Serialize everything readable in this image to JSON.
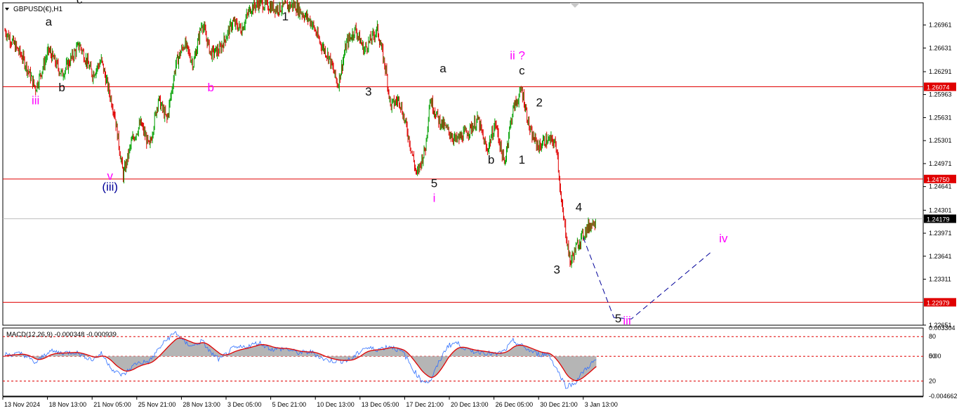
{
  "header": {
    "symbol_title": "GBPUSD(€),H1",
    "menu_icon": "triangle-down-icon"
  },
  "indicator": {
    "title": "MACD(12,26,9) -0.000348 -0.000939"
  },
  "colors": {
    "bull": "#00a000",
    "bear": "#e00000",
    "level": "#e00000",
    "wave_pink": "#ff00ff",
    "wave_navy": "#000099",
    "wave_black": "#111111",
    "projection": "#000099"
  },
  "chart_data": [
    {
      "type": "candlestick",
      "title": "GBPUSD(€),H1",
      "timeframe": "H1",
      "ylim": [
        1.2265,
        1.2728
      ],
      "price_ticks": [
        "1.26961",
        "1.26631",
        "1.26291",
        "1.25963",
        "1.25631",
        "1.25301",
        "1.24971",
        "1.24641",
        "1.24301",
        "1.23971",
        "1.23641",
        "1.23311",
        "1.22651"
      ],
      "x_labels": [
        "13 Nov 2024",
        "18 Nov 13:00",
        "21 Nov 05:00",
        "25 Nov 21:00",
        "28 Nov 13:00",
        "3 Dec 05:00",
        "5 Dec 21:00",
        "10 Dec 13:00",
        "13 Dec 05:00",
        "17 Dec 21:00",
        "20 Dec 13:00",
        "26 Dec 05:00",
        "30 Dec 21:00",
        "3 Jan 13:00"
      ],
      "price_path": [
        [
          0,
          1.2688
        ],
        [
          4,
          1.265
        ],
        [
          7,
          1.2605
        ],
        [
          10,
          1.266
        ],
        [
          13,
          1.2625
        ],
        [
          17,
          1.2668
        ],
        [
          20,
          1.2625
        ],
        [
          22,
          1.2645
        ],
        [
          25,
          1.257
        ],
        [
          27,
          1.248
        ],
        [
          29,
          1.253
        ],
        [
          31,
          1.2555
        ],
        [
          33,
          1.252
        ],
        [
          35,
          1.259
        ],
        [
          37,
          1.256
        ],
        [
          39,
          1.264
        ],
        [
          41,
          1.267
        ],
        [
          43,
          1.264
        ],
        [
          45,
          1.27
        ],
        [
          47,
          1.2655
        ],
        [
          49,
          1.266
        ],
        [
          52,
          1.27
        ],
        [
          54,
          1.269
        ],
        [
          56,
          1.272
        ],
        [
          58,
          1.2728
        ],
        [
          62,
          1.272
        ],
        [
          66,
          1.2725
        ],
        [
          70,
          1.27
        ],
        [
          72,
          1.267
        ],
        [
          74,
          1.265
        ],
        [
          76,
          1.261
        ],
        [
          78,
          1.267
        ],
        [
          80,
          1.269
        ],
        [
          82,
          1.266
        ],
        [
          85,
          1.269
        ],
        [
          87,
          1.263
        ],
        [
          88,
          1.258
        ],
        [
          90,
          1.259
        ],
        [
          92,
          1.254
        ],
        [
          94,
          1.248
        ],
        [
          96,
          1.252
        ],
        [
          97,
          1.259
        ],
        [
          99,
          1.256
        ],
        [
          101,
          1.2545
        ],
        [
          103,
          1.253
        ],
        [
          106,
          1.2545
        ],
        [
          108,
          1.256
        ],
        [
          110,
          1.2515
        ],
        [
          112,
          1.2555
        ],
        [
          114,
          1.2495
        ],
        [
          115,
          1.254
        ],
        [
          116,
          1.2575
        ],
        [
          118,
          1.2603
        ],
        [
          120,
          1.254
        ],
        [
          122,
          1.252
        ],
        [
          123,
          1.253
        ],
        [
          125,
          1.253
        ],
        [
          126,
          1.252
        ],
        [
          127,
          1.244
        ],
        [
          128,
          1.24
        ],
        [
          129,
          1.2355
        ],
        [
          131,
          1.2385
        ],
        [
          133,
          1.2405
        ],
        [
          135,
          1.2418
        ]
      ],
      "horizontal_levels": [
        {
          "price": 1.26074,
          "label": "1.26074",
          "color": "#e00000"
        },
        {
          "price": 1.2475,
          "label": "1.24750",
          "color": "#e00000"
        },
        {
          "price": 1.24179,
          "label": "1.24179",
          "color": "#bdbdbd",
          "current": true
        },
        {
          "price": 1.22979,
          "label": "1.22979",
          "color": "#e00000"
        }
      ],
      "wave_labels": [
        {
          "text": "a",
          "bar": 10,
          "price": 1.2695,
          "color": "black"
        },
        {
          "text": "c",
          "bar": 17,
          "price": 1.2727,
          "color": "black"
        },
        {
          "text": "b",
          "bar": 13,
          "price": 1.2601,
          "color": "black"
        },
        {
          "text": "iii",
          "bar": 7,
          "price": 1.2582,
          "color": "magenta"
        },
        {
          "text": "v",
          "bar": 24,
          "price": 1.2474,
          "color": "magenta"
        },
        {
          "text": "(iii)",
          "bar": 24,
          "price": 1.2458,
          "color": "navy"
        },
        {
          "text": "b",
          "bar": 47,
          "price": 1.2601,
          "color": "magenta"
        },
        {
          "text": "1",
          "bar": 64,
          "price": 1.2703,
          "color": "black"
        },
        {
          "text": "3",
          "bar": 83,
          "price": 1.2595,
          "color": "black"
        },
        {
          "text": "a",
          "bar": 100,
          "price": 1.2628,
          "color": "black"
        },
        {
          "text": "5",
          "bar": 98,
          "price": 1.2463,
          "color": "black"
        },
        {
          "text": "i",
          "bar": 98,
          "price": 1.2442,
          "color": "magenta"
        },
        {
          "text": "b",
          "bar": 111,
          "price": 1.2497,
          "color": "black"
        },
        {
          "text": "ii ?",
          "bar": 117,
          "price": 1.2647,
          "color": "magenta"
        },
        {
          "text": "c",
          "bar": 118,
          "price": 1.2625,
          "color": "black"
        },
        {
          "text": "2",
          "bar": 122,
          "price": 1.2579,
          "color": "black"
        },
        {
          "text": "1",
          "bar": 118,
          "price": 1.2497,
          "color": "black"
        },
        {
          "text": "4",
          "bar": 131,
          "price": 1.2429,
          "color": "black"
        },
        {
          "text": "3",
          "bar": 126,
          "price": 1.2339,
          "color": "black"
        },
        {
          "text": "5",
          "bar": 140,
          "price": 1.2269,
          "color": "black"
        },
        {
          "text": "iii",
          "bar": 142,
          "price": 1.2266,
          "color": "magenta"
        },
        {
          "text": "iv",
          "bar": 164,
          "price": 1.2384,
          "color": "magenta"
        }
      ],
      "projection": [
        [
          132,
          1.2391
        ],
        [
          139,
          1.2276
        ],
        [
          143,
          1.2274
        ],
        [
          161,
          1.2369
        ]
      ]
    },
    {
      "type": "line",
      "title": "MACD(12,26,9) -0.000348 -0.000939",
      "series": [
        {
          "role": "main",
          "color": "#3070ff"
        },
        {
          "role": "signal",
          "color": "#e00000"
        },
        {
          "role": "histogram",
          "color": "#b5b5b5"
        }
      ],
      "ylim": [
        -0.004662,
        0.003304
      ],
      "value_ticks": [
        "0.003304",
        "0.00",
        "-0.004662"
      ],
      "levels": [
        "80",
        "50",
        "20"
      ],
      "macd_path": [
        [
          0,
          0.0002
        ],
        [
          4,
          0.0003
        ],
        [
          7,
          -0.0008
        ],
        [
          10,
          0.0006
        ],
        [
          13,
          0.0004
        ],
        [
          16,
          0.0005
        ],
        [
          20,
          -0.0004
        ],
        [
          22,
          0.0003
        ],
        [
          25,
          -0.0018
        ],
        [
          27,
          -0.0022
        ],
        [
          30,
          -0.0008
        ],
        [
          33,
          -0.0006
        ],
        [
          35,
          0.0008
        ],
        [
          37,
          0.002
        ],
        [
          39,
          0.0028
        ],
        [
          41,
          0.0016
        ],
        [
          43,
          0.0012
        ],
        [
          45,
          0.0018
        ],
        [
          47,
          0.0004
        ],
        [
          49,
          -0.0004
        ],
        [
          52,
          0.0009
        ],
        [
          55,
          0.0011
        ],
        [
          58,
          0.0016
        ],
        [
          61,
          0.0008
        ],
        [
          64,
          0.0009
        ],
        [
          67,
          0.0004
        ],
        [
          70,
          0.0005
        ],
        [
          73,
          -0.0004
        ],
        [
          76,
          -0.0006
        ],
        [
          79,
          -0.0004
        ],
        [
          82,
          0.001
        ],
        [
          85,
          0.0008
        ],
        [
          88,
          0.0012
        ],
        [
          91,
          0.0004
        ],
        [
          93,
          -0.0014
        ],
        [
          95,
          -0.0028
        ],
        [
          97,
          -0.003
        ],
        [
          99,
          -0.0008
        ],
        [
          101,
          0.0012
        ],
        [
          103,
          0.0016
        ],
        [
          106,
          0.0006
        ],
        [
          109,
          0.0005
        ],
        [
          112,
          0.0002
        ],
        [
          114,
          0.0006
        ],
        [
          116,
          0.0018
        ],
        [
          118,
          0.0012
        ],
        [
          120,
          0.0006
        ],
        [
          122,
          0.0002
        ],
        [
          124,
          0.0003
        ],
        [
          126,
          -0.0015
        ],
        [
          128,
          -0.0035
        ],
        [
          130,
          -0.0032
        ],
        [
          132,
          -0.0018
        ],
        [
          134,
          -0.0008
        ],
        [
          135,
          -0.0004
        ]
      ]
    }
  ]
}
